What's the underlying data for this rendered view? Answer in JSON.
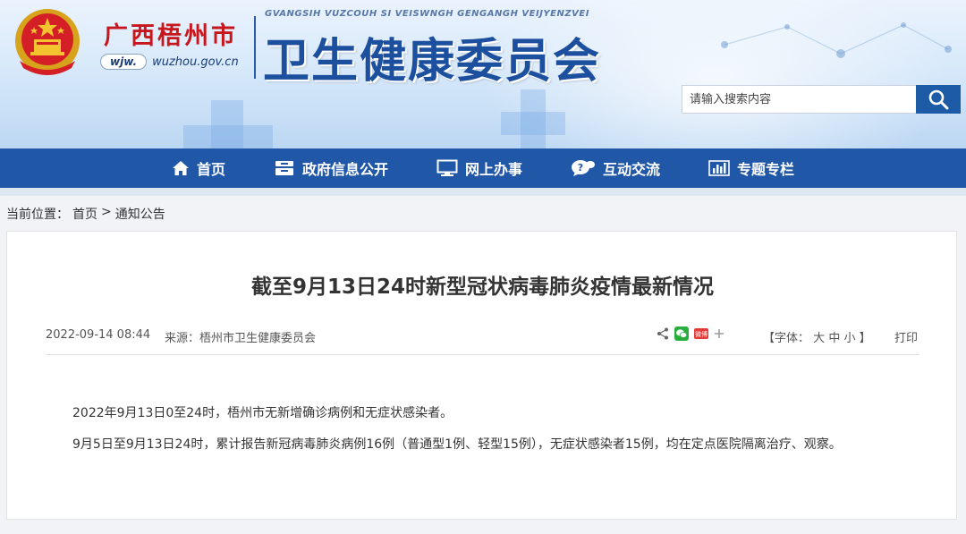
{
  "header": {
    "city": "广西梧州市",
    "abbr": "wjw.",
    "domain": "wuzhou.gov.cn",
    "pinyin": "GVANGSIH VUZCOUH SI VEISWNGH GENGANGH VEIJYENZVEI",
    "title": "卫生健康委员会",
    "search_placeholder": "请输入搜索内容",
    "colors": {
      "brand_red": "#c8161d",
      "brand_blue": "#1d4f9f",
      "nav_blue": "#2157a7"
    }
  },
  "nav": [
    {
      "label": "首页",
      "icon": "home-icon"
    },
    {
      "label": "政府信息公开",
      "icon": "archive-icon"
    },
    {
      "label": "网上办事",
      "icon": "monitor-icon"
    },
    {
      "label": "互动交流",
      "icon": "chat-icon"
    },
    {
      "label": "专题专栏",
      "icon": "bar-chart-icon"
    }
  ],
  "breadcrumb": {
    "prefix": "当前位置：",
    "home": "首页",
    "sep": ">",
    "current": "通知公告"
  },
  "article": {
    "title": "截至9月13日24时新型冠状病毒肺炎疫情最新情况",
    "date": "2022-09-14 08:44",
    "source_label": "来源：",
    "source": "梧州市卫生健康委员会",
    "weibo_badge": "微博",
    "font_open": "【字体：",
    "font_large": "大",
    "font_medium": "中",
    "font_small": "小",
    "font_close": "】",
    "print": "打印",
    "paragraphs": [
      "2022年9月13日0至24时，梧州市无新增确诊病例和无症状感染者。",
      "9月5日至9月13日24时，累计报告新冠病毒肺炎病例16例（普通型1例、轻型15例），无症状感染者15例，均在定点医院隔离治疗、观察。"
    ]
  }
}
